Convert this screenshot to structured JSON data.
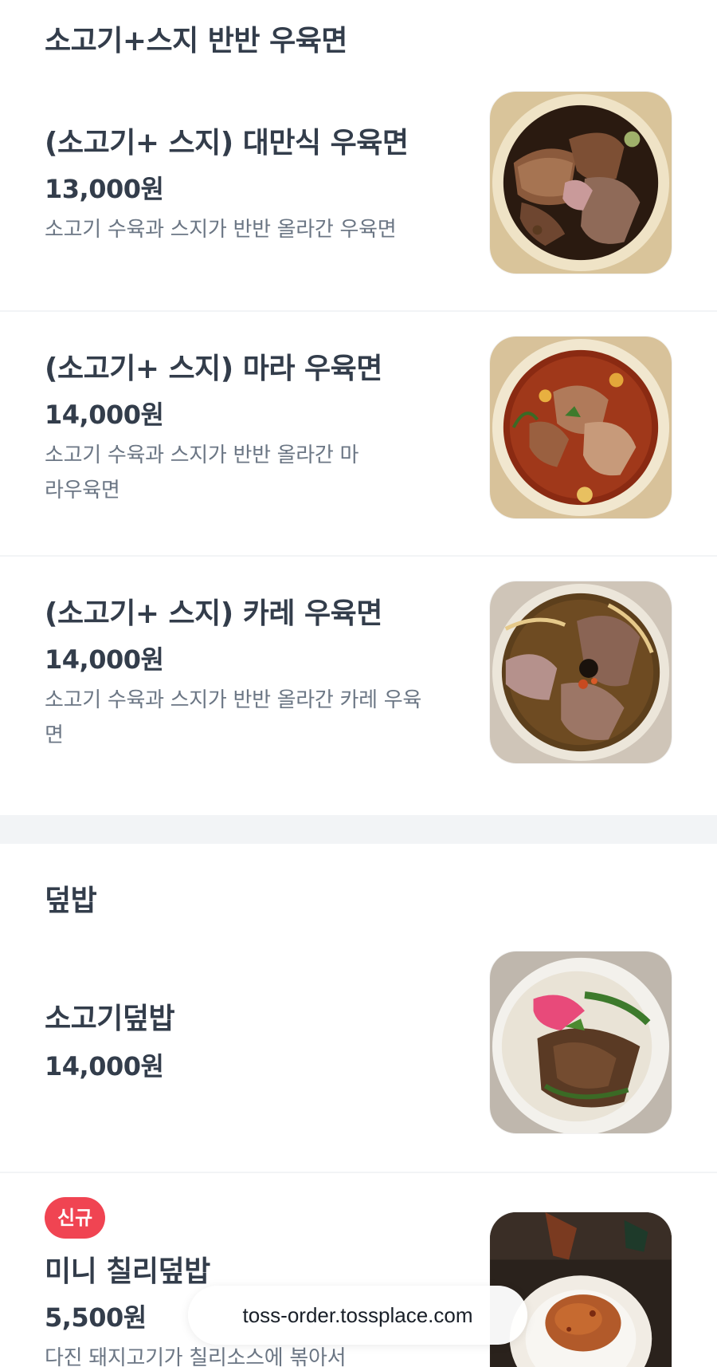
{
  "sections": [
    {
      "title": "소고기+스지 반반 우육면",
      "items": [
        {
          "name": "(소고기+ 스지) 대만식 우육면",
          "price": "13,000원",
          "description": "소고기 수육과 스지가 반반 올라간 우육면"
        },
        {
          "name": "(소고기+ 스지) 마라 우육면",
          "price": "14,000원",
          "description": "소고기 수육과 스지가 반반 올라간 마라우육면"
        },
        {
          "name": "(소고기+ 스지) 카레 우육면",
          "price": "14,000원",
          "description": "소고기 수육과 스지가 반반 올라간 카레 우육면"
        }
      ]
    },
    {
      "title": "덮밥",
      "items": [
        {
          "name": "소고기덮밥",
          "price": "14,000원"
        },
        {
          "badge": "신규",
          "name": "미니 칠리덮밥",
          "price": "5,500원",
          "description": "다진 돼지고기가 칠리소스에 볶아서"
        }
      ]
    }
  ],
  "url_bar": {
    "text": "toss-order.tossplace.com"
  },
  "colors": {
    "text_primary": "#333d4b",
    "text_secondary": "#6b7684",
    "divider": "#f2f4f6",
    "badge_new": "#f04452"
  },
  "icons": {
    "food_photos": [
      "beef-noodle-soup-photo",
      "mala-noodle-soup-photo",
      "curry-noodle-soup-photo",
      "beef-rice-bowl-photo",
      "chili-rice-bowl-photo"
    ]
  }
}
